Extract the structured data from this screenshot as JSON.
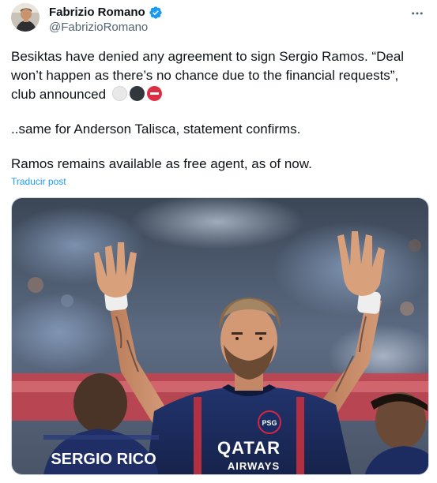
{
  "author": {
    "name": "Fabrizio Romano",
    "handle": "@FabrizioRomano",
    "verified": true
  },
  "tweet": {
    "paragraph1": "Besiktas have denied any agreement to sign Sergio Ramos. “Deal won’t happen as there’s no chance due to the financial requests”, club announced",
    "paragraph2": "..same for Anderson Talisca, statement confirms.",
    "paragraph3": "Ramos remains available as free agent, as of now.",
    "emojis": [
      "white-circle",
      "black-circle",
      "no-entry"
    ]
  },
  "translate_label": "Traducir post",
  "media": {
    "sponsor_line1": "QATAR",
    "sponsor_line2": "AIRWAYS",
    "back_name": "SERGIO RICO",
    "crest_text": "PSG"
  },
  "colors": {
    "link": "#1d9bf0",
    "verified": "#1d9bf0",
    "secondary_text": "#536471",
    "jersey": "#1b2a5c",
    "jersey_red": "#d7263d"
  }
}
